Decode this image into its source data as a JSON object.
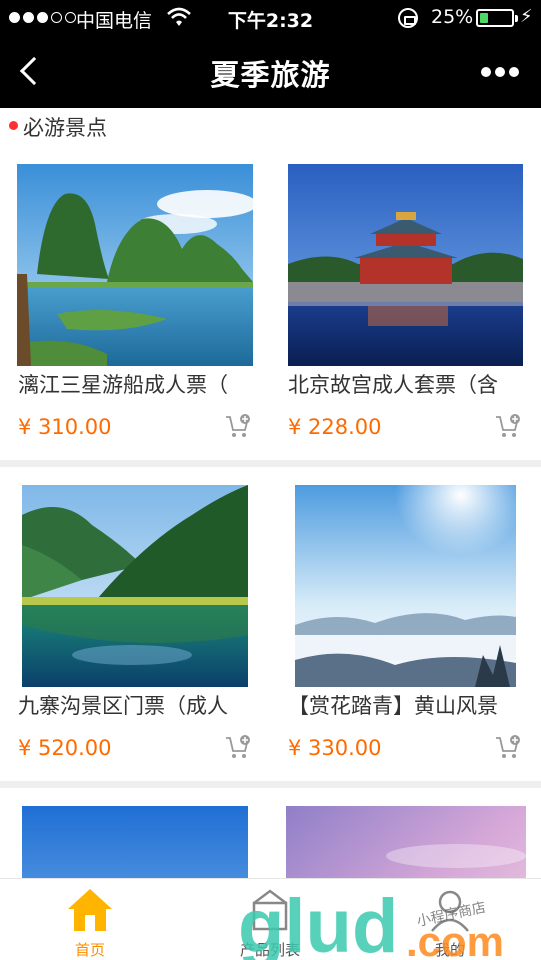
{
  "status_bar": {
    "carrier": "中国电信",
    "time": "下午2:32",
    "battery_percent": "25%",
    "battery_level": 0.25,
    "signal_bars_filled": 3,
    "signal_bars_total": 5
  },
  "nav": {
    "title": "夏季旅游",
    "back_icon": "chevron-left-icon",
    "more_icon": "more-dots-icon"
  },
  "section": {
    "label": "必游景点",
    "dot_color": "#ff3030"
  },
  "theme": {
    "price_color": "#ff6a00",
    "active_tab_color": "#ff8c00",
    "inactive_tab_color": "#555555"
  },
  "products": [
    {
      "name": "漓江三星游船成人票（",
      "price": "¥ 310.00",
      "image": "lijiang-karst-river"
    },
    {
      "name": "北京故宫成人套票（含",
      "price": "¥ 228.00",
      "image": "forbidden-city-moat"
    },
    {
      "name": "九寨沟景区门票（成人",
      "price": "¥ 520.00",
      "image": "jiuzhaigou-lake"
    },
    {
      "name": "【赏花踏青】黄山风景",
      "price": "¥ 330.00",
      "image": "huangshan-sea-of-clouds"
    },
    {
      "name": "",
      "price": "",
      "image": "blue-sky"
    },
    {
      "name": "",
      "price": "",
      "image": "purple-sunset-sky"
    }
  ],
  "tabs": [
    {
      "label": "首页",
      "icon": "home-icon",
      "active": true
    },
    {
      "label": "产品列表",
      "icon": "product-list-icon",
      "active": false
    },
    {
      "label": "我的",
      "icon": "profile-icon",
      "active": false
    }
  ],
  "watermark": {
    "text_main": "glud",
    "text_dot": ".com",
    "text_small": "小程序商店"
  }
}
